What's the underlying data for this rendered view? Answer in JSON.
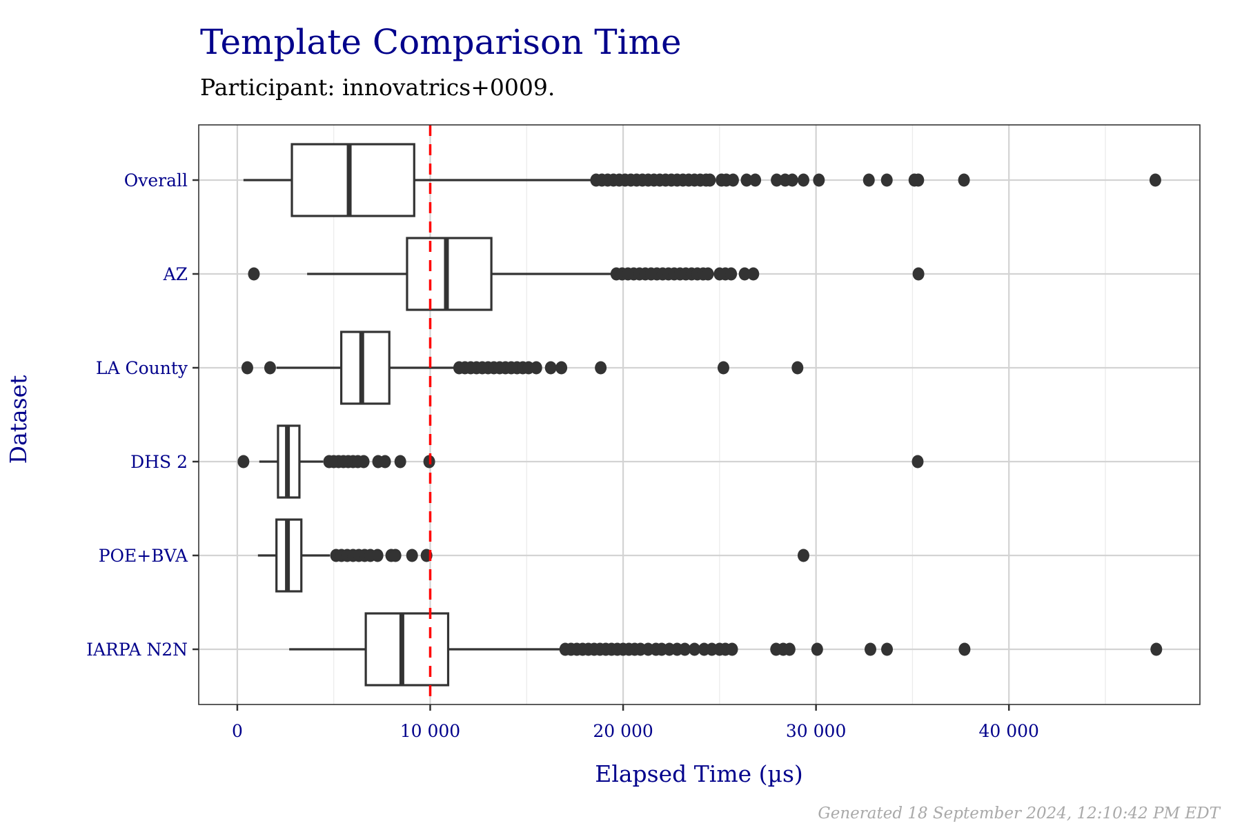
{
  "chart_data": {
    "type": "boxplot",
    "orientation": "horizontal",
    "title": "Template Comparison Time",
    "subtitle": "Participant: innovatrics+0009.",
    "xlabel": "Elapsed Time (µs)",
    "ylabel": "Dataset",
    "caption": "Generated 18 September 2024, 12:10:42 PM EDT",
    "xlim": [
      -2000,
      49900
    ],
    "x_ticks": [
      0,
      10000,
      20000,
      30000,
      40000
    ],
    "x_tick_labels": [
      "0",
      "10 000",
      "20 000",
      "30 000",
      "40 000"
    ],
    "x_minor_ticks": [
      5000,
      15000,
      25000,
      35000,
      45000
    ],
    "grid": true,
    "reference_line": {
      "value": 10000,
      "color": "#FF0000",
      "style": "dashed"
    },
    "colors": {
      "box": "#333333",
      "outlier": "#333333",
      "title": "#00008B",
      "axis_text": "#00008B",
      "grid": "#D3D3D3",
      "caption": "#A9A9A9"
    },
    "categories": [
      "Overall",
      "AZ",
      "LA County",
      "DHS 2",
      "POE+BVA",
      "IARPA N2N"
    ],
    "series": [
      {
        "name": "Overall",
        "whisker_low": 320,
        "q1": 2830,
        "median": 5800,
        "q3": 9170,
        "whisker_high": 18300,
        "outliers": [
          18600,
          18900,
          19200,
          19500,
          19800,
          20100,
          20400,
          20700,
          21000,
          21300,
          21600,
          21900,
          22200,
          22500,
          22800,
          23100,
          23400,
          23700,
          24000,
          24300,
          24500,
          25100,
          25350,
          25700,
          26400,
          26850,
          27960,
          28400,
          28770,
          29350,
          30150,
          32740,
          33670,
          35100,
          35300,
          37670,
          47590
        ]
      },
      {
        "name": "AZ",
        "whisker_low": 3620,
        "q1": 8800,
        "median": 10840,
        "q3": 13170,
        "whisker_high": 19400,
        "outliers": [
          860,
          19650,
          19950,
          20250,
          20550,
          20850,
          21150,
          21450,
          21750,
          22050,
          22350,
          22650,
          22950,
          23250,
          23550,
          23850,
          24150,
          24400,
          25000,
          25300,
          25600,
          26300,
          26750,
          35310
        ]
      },
      {
        "name": "LA County",
        "whisker_low": 2030,
        "q1": 5390,
        "median": 6450,
        "q3": 7880,
        "whisker_high": 11400,
        "outliers": [
          520,
          1700,
          11500,
          11800,
          12100,
          12400,
          12700,
          13000,
          13300,
          13600,
          13900,
          14200,
          14500,
          14800,
          15100,
          15500,
          16250,
          16800,
          18840,
          25200,
          29040
        ]
      },
      {
        "name": "DHS 2",
        "whisker_low": 1140,
        "q1": 2110,
        "median": 2600,
        "q3": 3220,
        "whisker_high": 4450,
        "outliers": [
          320,
          4760,
          5000,
          5250,
          5500,
          5750,
          6000,
          6250,
          6550,
          7300,
          7660,
          8450,
          9950,
          35270
        ]
      },
      {
        "name": "POE+BVA",
        "whisker_low": 1070,
        "q1": 2030,
        "median": 2600,
        "q3": 3320,
        "whisker_high": 4800,
        "outliers": [
          5120,
          5400,
          5700,
          6000,
          6300,
          6600,
          6900,
          7270,
          7980,
          8200,
          9060,
          9810,
          29350
        ]
      },
      {
        "name": "IARPA N2N",
        "whisker_low": 2690,
        "q1": 6660,
        "median": 8530,
        "q3": 10930,
        "whisker_high": 16900,
        "outliers": [
          17000,
          17300,
          17600,
          17900,
          18200,
          18500,
          18800,
          19100,
          19400,
          19700,
          20000,
          20300,
          20600,
          20900,
          21300,
          21700,
          22000,
          22400,
          22800,
          23200,
          23700,
          24200,
          24600,
          25000,
          25300,
          25650,
          27930,
          28300,
          28630,
          30060,
          32820,
          33680,
          37700,
          47640
        ]
      }
    ]
  }
}
